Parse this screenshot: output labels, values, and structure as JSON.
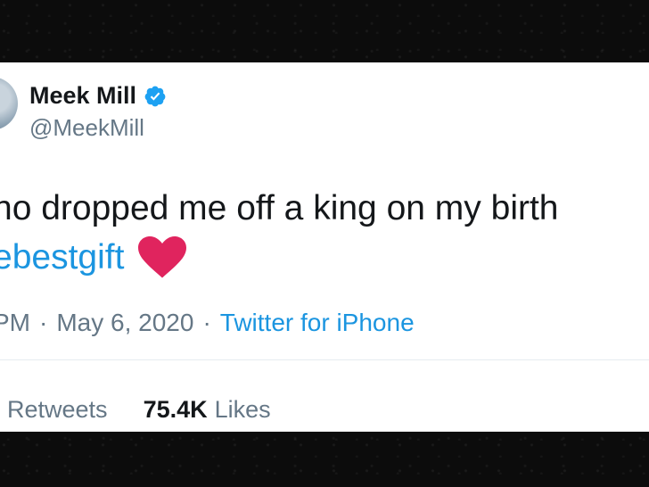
{
  "tweet": {
    "display_name": "Meek Mill",
    "handle": "@MeekMill",
    "verified_icon": "verified-badge-icon",
    "text": "no dropped me off a king on my birth",
    "hashtag": "ebestgift",
    "emoji": "red-heart-icon",
    "time": "PM",
    "separator": "·",
    "date": "May 6, 2020",
    "source": "Twitter for iPhone",
    "retweets_label": "Retweets",
    "likes_count": "75.4K",
    "likes_label": "Likes"
  },
  "colors": {
    "link": "#1b95e0",
    "secondary_text": "#657786",
    "primary_text": "#14171a",
    "heart": "#e0245e",
    "verified": "#1da1f2"
  }
}
